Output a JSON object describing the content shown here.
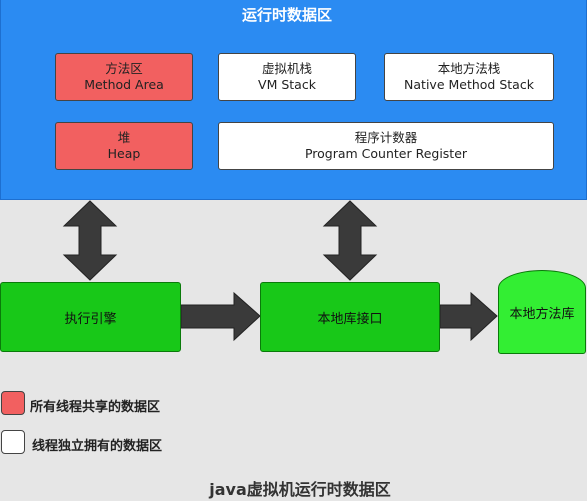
{
  "runtime_area": {
    "title": "运行时数据区"
  },
  "boxes": {
    "method_area": {
      "cn": "方法区",
      "en": "Method Area"
    },
    "vm_stack": {
      "cn": "虚拟机栈",
      "en": "VM Stack"
    },
    "native_stack": {
      "cn": "本地方法栈",
      "en": "Native Method Stack"
    },
    "heap": {
      "cn": "堆",
      "en": "Heap"
    },
    "pc_register": {
      "cn": "程序计数器",
      "en": "Program Counter Register"
    }
  },
  "components": {
    "execution_engine": "执行引擎",
    "native_interface": "本地库接口",
    "native_library": "本地方法库"
  },
  "legend": {
    "shared": "所有线程共享的数据区",
    "private": "线程独立拥有的数据区"
  },
  "footer": {
    "title": "java虚拟机运行时数据区"
  },
  "colors": {
    "runtime_bg": "#2b8bf2",
    "shared": "#f26060",
    "private": "#ffffff",
    "component": "#18c818",
    "library": "#33ee33",
    "arrow": "#3a3a3a"
  }
}
